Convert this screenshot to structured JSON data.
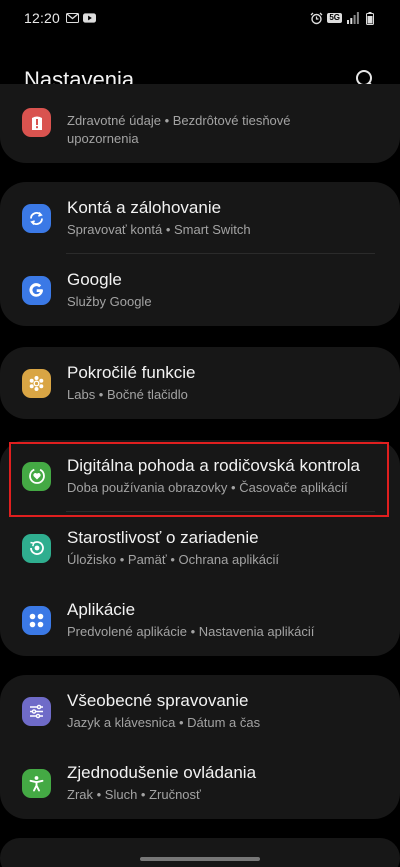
{
  "status_bar": {
    "time": "12:20",
    "left_icons": [
      "gmail-icon",
      "youtube-icon"
    ],
    "right_icons": [
      "alarm-icon",
      "5g-icon",
      "signal-icon",
      "battery-icon"
    ],
    "network": "5G"
  },
  "header": {
    "title": "Nastavenia",
    "search_icon": "search-icon"
  },
  "groups": [
    {
      "items": [
        {
          "icon": "safety-icon",
          "color": "#d9534f",
          "title": "",
          "subtitle": "Zdravotné údaje • Bezdrôtové tiesňové upozornenia"
        }
      ]
    },
    {
      "items": [
        {
          "icon": "sync-icon",
          "color": "#3b79e6",
          "title": "Kontá a zálohovanie",
          "subtitle": "Spravovať kontá • Smart Switch"
        },
        {
          "icon": "google-icon",
          "color": "#3b79e6",
          "title": "Google",
          "subtitle": "Služby Google"
        }
      ]
    },
    {
      "items": [
        {
          "icon": "advanced-features-icon",
          "color": "#d9a544",
          "title": "Pokročilé funkcie",
          "subtitle": "Labs • Bočné tlačidlo"
        }
      ]
    },
    {
      "items": [
        {
          "icon": "digital-wellbeing-icon",
          "color": "#44a944",
          "title": "Digitálna pohoda a rodičovská kontrola",
          "subtitle": "Doba používania obrazovky • Časovače aplikácií",
          "highlighted": true
        },
        {
          "icon": "device-care-icon",
          "color": "#2fae8f",
          "title": "Starostlivosť o zariadenie",
          "subtitle": "Úložisko • Pamäť • Ochrana aplikácií"
        },
        {
          "icon": "apps-icon",
          "color": "#3b79e6",
          "title": "Aplikácie",
          "subtitle": "Predvolené aplikácie • Nastavenia aplikácií"
        }
      ]
    },
    {
      "items": [
        {
          "icon": "general-management-icon",
          "color": "#6f6bc8",
          "title": "Všeobecné spravovanie",
          "subtitle": "Jazyk a klávesnica • Dátum a čas"
        },
        {
          "icon": "accessibility-icon",
          "color": "#44a944",
          "title": "Zjednodušenie ovládania",
          "subtitle": "Zrak • Sluch • Zručnosť"
        }
      ]
    }
  ],
  "highlight_color": "#e01f1f"
}
